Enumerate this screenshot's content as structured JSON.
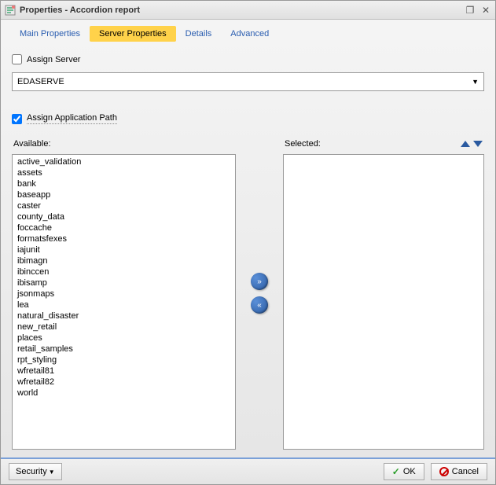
{
  "window": {
    "title": "Properties - Accordion report"
  },
  "tabs": [
    {
      "label": "Main Properties",
      "active": false
    },
    {
      "label": "Server Properties",
      "active": true
    },
    {
      "label": "Details",
      "active": false
    },
    {
      "label": "Advanced",
      "active": false
    }
  ],
  "assign_server": {
    "label": "Assign Server",
    "checked": false
  },
  "server_dropdown": {
    "value": "EDASERVE"
  },
  "assign_app_path": {
    "label": "Assign Application Path",
    "checked": true
  },
  "available_label": "Available:",
  "selected_label": "Selected:",
  "available_items": [
    "active_validation",
    "assets",
    "bank",
    "baseapp",
    "caster",
    "county_data",
    "foccache",
    "formatsfexes",
    "iajunit",
    "ibimagn",
    "ibinccen",
    "ibisamp",
    "jsonmaps",
    "lea",
    "natural_disaster",
    "new_retail",
    "places",
    "retail_samples",
    "rpt_styling",
    "wfretail81",
    "wfretail82",
    "world"
  ],
  "selected_items": [],
  "footer": {
    "security": "Security",
    "ok": "OK",
    "cancel": "Cancel"
  }
}
